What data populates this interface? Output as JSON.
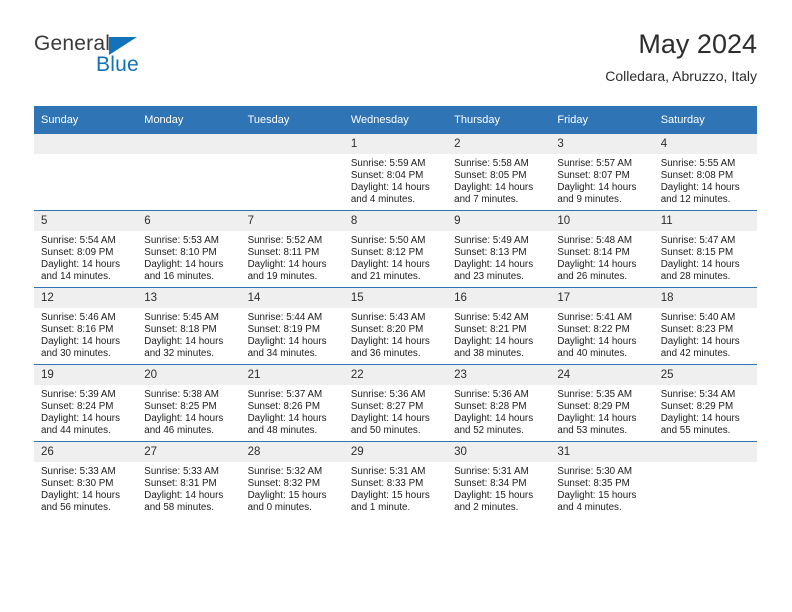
{
  "brand": {
    "name_top": "General",
    "name_bottom": "Blue",
    "accent_color": "#1273ba"
  },
  "header": {
    "title": "May 2024",
    "subtitle": "Colledara, Abruzzo, Italy"
  },
  "theme": {
    "header_blue": "#2f74b5",
    "daynum_band": "#efefef",
    "text": "#1c1c1c"
  },
  "calendar": {
    "weekday_headers": [
      "Sunday",
      "Monday",
      "Tuesday",
      "Wednesday",
      "Thursday",
      "Friday",
      "Saturday"
    ],
    "labels": {
      "sunrise": "Sunrise:",
      "sunset": "Sunset:",
      "daylight": "Daylight:"
    },
    "weeks": [
      [
        {
          "day": "",
          "blank": true,
          "line1": "",
          "line2": "",
          "line3": "",
          "line4": ""
        },
        {
          "day": "",
          "blank": true,
          "line1": "",
          "line2": "",
          "line3": "",
          "line4": ""
        },
        {
          "day": "",
          "blank": true,
          "line1": "",
          "line2": "",
          "line3": "",
          "line4": ""
        },
        {
          "day": "1",
          "blank": false,
          "line1": "Sunrise: 5:59 AM",
          "line2": "Sunset: 8:04 PM",
          "line3": "Daylight: 14 hours",
          "line4": "and 4 minutes."
        },
        {
          "day": "2",
          "blank": false,
          "line1": "Sunrise: 5:58 AM",
          "line2": "Sunset: 8:05 PM",
          "line3": "Daylight: 14 hours",
          "line4": "and 7 minutes."
        },
        {
          "day": "3",
          "blank": false,
          "line1": "Sunrise: 5:57 AM",
          "line2": "Sunset: 8:07 PM",
          "line3": "Daylight: 14 hours",
          "line4": "and 9 minutes."
        },
        {
          "day": "4",
          "blank": false,
          "line1": "Sunrise: 5:55 AM",
          "line2": "Sunset: 8:08 PM",
          "line3": "Daylight: 14 hours",
          "line4": "and 12 minutes."
        }
      ],
      [
        {
          "day": "5",
          "blank": false,
          "line1": "Sunrise: 5:54 AM",
          "line2": "Sunset: 8:09 PM",
          "line3": "Daylight: 14 hours",
          "line4": "and 14 minutes."
        },
        {
          "day": "6",
          "blank": false,
          "line1": "Sunrise: 5:53 AM",
          "line2": "Sunset: 8:10 PM",
          "line3": "Daylight: 14 hours",
          "line4": "and 16 minutes."
        },
        {
          "day": "7",
          "blank": false,
          "line1": "Sunrise: 5:52 AM",
          "line2": "Sunset: 8:11 PM",
          "line3": "Daylight: 14 hours",
          "line4": "and 19 minutes."
        },
        {
          "day": "8",
          "blank": false,
          "line1": "Sunrise: 5:50 AM",
          "line2": "Sunset: 8:12 PM",
          "line3": "Daylight: 14 hours",
          "line4": "and 21 minutes."
        },
        {
          "day": "9",
          "blank": false,
          "line1": "Sunrise: 5:49 AM",
          "line2": "Sunset: 8:13 PM",
          "line3": "Daylight: 14 hours",
          "line4": "and 23 minutes."
        },
        {
          "day": "10",
          "blank": false,
          "line1": "Sunrise: 5:48 AM",
          "line2": "Sunset: 8:14 PM",
          "line3": "Daylight: 14 hours",
          "line4": "and 26 minutes."
        },
        {
          "day": "11",
          "blank": false,
          "line1": "Sunrise: 5:47 AM",
          "line2": "Sunset: 8:15 PM",
          "line3": "Daylight: 14 hours",
          "line4": "and 28 minutes."
        }
      ],
      [
        {
          "day": "12",
          "blank": false,
          "line1": "Sunrise: 5:46 AM",
          "line2": "Sunset: 8:16 PM",
          "line3": "Daylight: 14 hours",
          "line4": "and 30 minutes."
        },
        {
          "day": "13",
          "blank": false,
          "line1": "Sunrise: 5:45 AM",
          "line2": "Sunset: 8:18 PM",
          "line3": "Daylight: 14 hours",
          "line4": "and 32 minutes."
        },
        {
          "day": "14",
          "blank": false,
          "line1": "Sunrise: 5:44 AM",
          "line2": "Sunset: 8:19 PM",
          "line3": "Daylight: 14 hours",
          "line4": "and 34 minutes."
        },
        {
          "day": "15",
          "blank": false,
          "line1": "Sunrise: 5:43 AM",
          "line2": "Sunset: 8:20 PM",
          "line3": "Daylight: 14 hours",
          "line4": "and 36 minutes."
        },
        {
          "day": "16",
          "blank": false,
          "line1": "Sunrise: 5:42 AM",
          "line2": "Sunset: 8:21 PM",
          "line3": "Daylight: 14 hours",
          "line4": "and 38 minutes."
        },
        {
          "day": "17",
          "blank": false,
          "line1": "Sunrise: 5:41 AM",
          "line2": "Sunset: 8:22 PM",
          "line3": "Daylight: 14 hours",
          "line4": "and 40 minutes."
        },
        {
          "day": "18",
          "blank": false,
          "line1": "Sunrise: 5:40 AM",
          "line2": "Sunset: 8:23 PM",
          "line3": "Daylight: 14 hours",
          "line4": "and 42 minutes."
        }
      ],
      [
        {
          "day": "19",
          "blank": false,
          "line1": "Sunrise: 5:39 AM",
          "line2": "Sunset: 8:24 PM",
          "line3": "Daylight: 14 hours",
          "line4": "and 44 minutes."
        },
        {
          "day": "20",
          "blank": false,
          "line1": "Sunrise: 5:38 AM",
          "line2": "Sunset: 8:25 PM",
          "line3": "Daylight: 14 hours",
          "line4": "and 46 minutes."
        },
        {
          "day": "21",
          "blank": false,
          "line1": "Sunrise: 5:37 AM",
          "line2": "Sunset: 8:26 PM",
          "line3": "Daylight: 14 hours",
          "line4": "and 48 minutes."
        },
        {
          "day": "22",
          "blank": false,
          "line1": "Sunrise: 5:36 AM",
          "line2": "Sunset: 8:27 PM",
          "line3": "Daylight: 14 hours",
          "line4": "and 50 minutes."
        },
        {
          "day": "23",
          "blank": false,
          "line1": "Sunrise: 5:36 AM",
          "line2": "Sunset: 8:28 PM",
          "line3": "Daylight: 14 hours",
          "line4": "and 52 minutes."
        },
        {
          "day": "24",
          "blank": false,
          "line1": "Sunrise: 5:35 AM",
          "line2": "Sunset: 8:29 PM",
          "line3": "Daylight: 14 hours",
          "line4": "and 53 minutes."
        },
        {
          "day": "25",
          "blank": false,
          "line1": "Sunrise: 5:34 AM",
          "line2": "Sunset: 8:29 PM",
          "line3": "Daylight: 14 hours",
          "line4": "and 55 minutes."
        }
      ],
      [
        {
          "day": "26",
          "blank": false,
          "line1": "Sunrise: 5:33 AM",
          "line2": "Sunset: 8:30 PM",
          "line3": "Daylight: 14 hours",
          "line4": "and 56 minutes."
        },
        {
          "day": "27",
          "blank": false,
          "line1": "Sunrise: 5:33 AM",
          "line2": "Sunset: 8:31 PM",
          "line3": "Daylight: 14 hours",
          "line4": "and 58 minutes."
        },
        {
          "day": "28",
          "blank": false,
          "line1": "Sunrise: 5:32 AM",
          "line2": "Sunset: 8:32 PM",
          "line3": "Daylight: 15 hours",
          "line4": "and 0 minutes."
        },
        {
          "day": "29",
          "blank": false,
          "line1": "Sunrise: 5:31 AM",
          "line2": "Sunset: 8:33 PM",
          "line3": "Daylight: 15 hours",
          "line4": "and 1 minute."
        },
        {
          "day": "30",
          "blank": false,
          "line1": "Sunrise: 5:31 AM",
          "line2": "Sunset: 8:34 PM",
          "line3": "Daylight: 15 hours",
          "line4": "and 2 minutes."
        },
        {
          "day": "31",
          "blank": false,
          "line1": "Sunrise: 5:30 AM",
          "line2": "Sunset: 8:35 PM",
          "line3": "Daylight: 15 hours",
          "line4": "and 4 minutes."
        },
        {
          "day": "",
          "blank": true,
          "line1": "",
          "line2": "",
          "line3": "",
          "line4": ""
        }
      ]
    ]
  }
}
